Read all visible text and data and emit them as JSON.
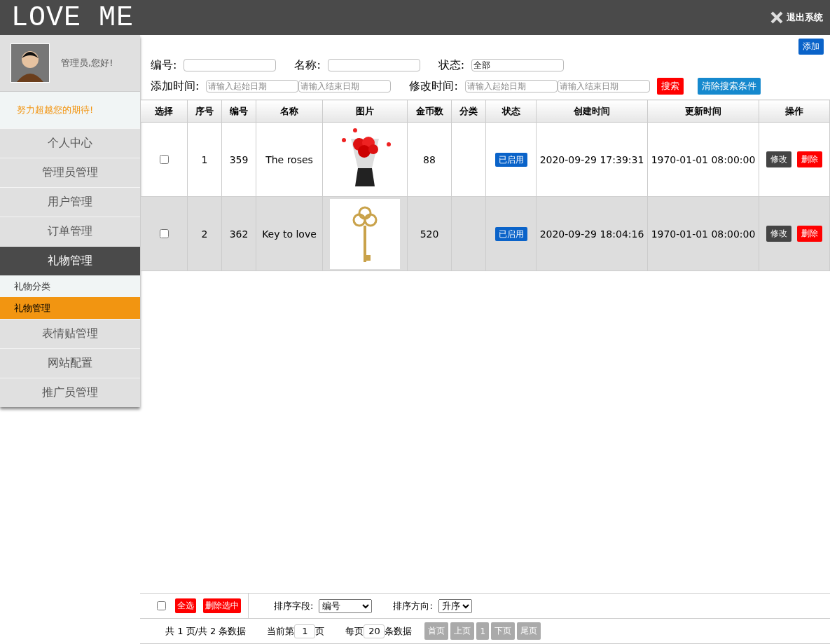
{
  "header": {
    "logo": "LOVE ME",
    "logout": "退出系统"
  },
  "sidebar": {
    "greeting": "管理员,您好!",
    "motto": "努力超越您的期待!",
    "menu": [
      {
        "label": "个人中心",
        "selected": false
      },
      {
        "label": "管理员管理",
        "selected": false
      },
      {
        "label": "用户管理",
        "selected": false
      },
      {
        "label": "订单管理",
        "selected": false
      },
      {
        "label": "礼物管理",
        "selected": true,
        "children": [
          {
            "label": "礼物分类",
            "selected": false
          },
          {
            "label": "礼物管理",
            "selected": true
          }
        ]
      },
      {
        "label": "表情贴管理",
        "selected": false
      },
      {
        "label": "网站配置",
        "selected": false
      },
      {
        "label": "推广员管理",
        "selected": false
      }
    ]
  },
  "add_button": "添加",
  "filters": {
    "id_label": "编号:",
    "name_label": "名称:",
    "status_label": "状态:",
    "status_value": "全部",
    "add_time_label": "添加时间:",
    "add_start_placeholder": "请输入起始日期",
    "add_end_placeholder": "请输入结束日期",
    "mod_time_label": "修改时间:",
    "mod_start_placeholder": "请输入起始日期",
    "mod_end_placeholder": "请输入结束日期",
    "search_button": "搜索",
    "clear_button": "清除搜索条件"
  },
  "table": {
    "columns": [
      "选择",
      "序号",
      "编号",
      "名称",
      "图片",
      "金币数",
      "分类",
      "状态",
      "创建时间",
      "更新时间",
      "操作"
    ],
    "rows": [
      {
        "checked": false,
        "index": "1",
        "id": "359",
        "name": "The roses",
        "coins": "88",
        "status": "已启用",
        "created": "2020-09-29 17:39:31",
        "updated": "1970-01-01 08:00:00",
        "edit": "修改",
        "delete": "删除"
      },
      {
        "checked": false,
        "index": "2",
        "id": "362",
        "name": "Key to love",
        "coins": "520",
        "status": "已启用",
        "created": "2020-09-29 18:04:16",
        "updated": "1970-01-01 08:00:00",
        "edit": "修改",
        "delete": "删除"
      }
    ]
  },
  "footer": {
    "select_all_checked": false,
    "select_all": "全选",
    "delete_selected": "删除选中",
    "sort_field_label": "排序字段:",
    "sort_field": "编号",
    "sort_dir_label": "排序方向:",
    "sort_dir": "升序",
    "summary": "共 1 页/共 2 条数据",
    "current_prefix": "当前第",
    "current_page": "1",
    "current_suffix": "页",
    "per_page_prefix": "每页",
    "per_page": "20",
    "per_page_suffix": "条数据",
    "pages": [
      "首页",
      "上页",
      "1",
      "下页",
      "尾页"
    ]
  }
}
